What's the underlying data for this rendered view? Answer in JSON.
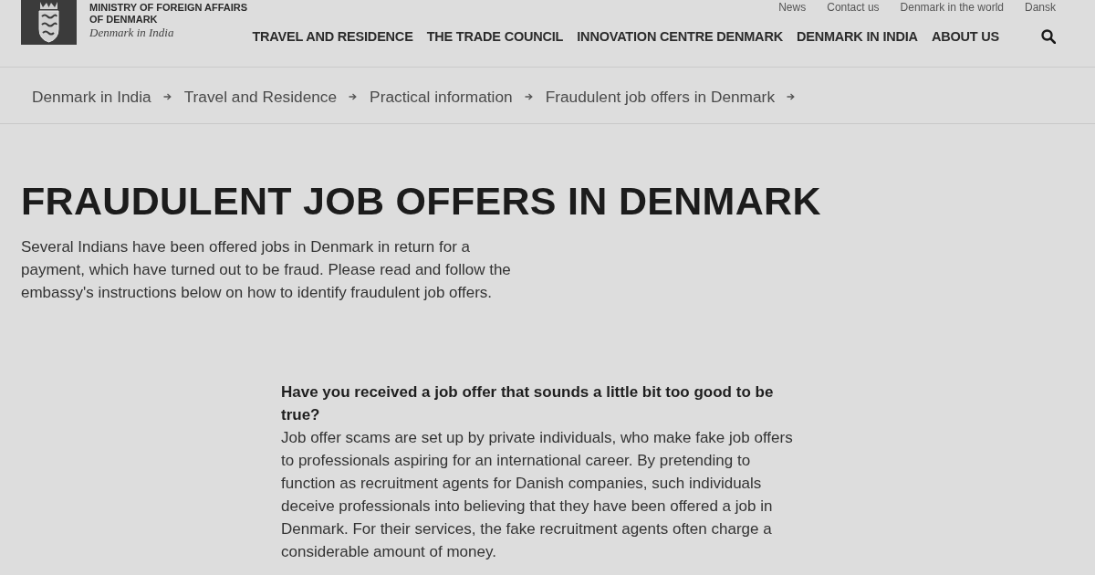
{
  "header": {
    "organisation_lines": [
      "MINISTRY OF FOREIGN AFFAIRS",
      "OF DENMARK"
    ],
    "subtitle": "Denmark in India",
    "utility_links": [
      "News",
      "Contact us",
      "Denmark in the world",
      "Dansk"
    ],
    "nav": [
      "TRAVEL AND RESIDENCE",
      "THE TRADE COUNCIL",
      "INNOVATION CENTRE DENMARK",
      "DENMARK IN INDIA",
      "ABOUT US"
    ]
  },
  "breadcrumb": [
    "Denmark in India",
    "Travel and Residence",
    "Practical information",
    "Fraudulent job offers in Denmark"
  ],
  "page": {
    "title": "FRAUDULENT JOB OFFERS IN DENMARK",
    "intro": "Several Indians have been offered jobs in Denmark in return for a payment, which have turned out to be fraud. Please read and follow the embassy's instructions below on how to identify fraudulent job offers.",
    "sections": [
      {
        "heading": "Have you received a job offer that sounds a little bit too good to be true?",
        "body": "Job offer scams are set up by private individuals, who make fake job offers to professionals aspiring for an international career. By pretending to function as recruitment agents for Danish companies, such individuals deceive professionals into believing that they have been offered a job in Denmark. For their services, the fake recruitment agents often charge a considerable amount of money."
      }
    ]
  }
}
